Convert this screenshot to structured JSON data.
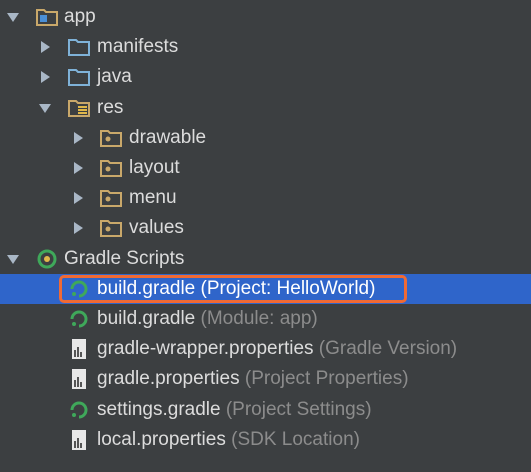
{
  "tree": {
    "rows": [
      {
        "label": "app",
        "secondary": "",
        "icon": "module-folder-icon",
        "arrow": "expanded"
      },
      {
        "label": "manifests",
        "secondary": "",
        "icon": "folder-icon",
        "arrow": "collapsed"
      },
      {
        "label": "java",
        "secondary": "",
        "icon": "folder-icon",
        "arrow": "collapsed"
      },
      {
        "label": "res",
        "secondary": "",
        "icon": "resource-folder-icon",
        "arrow": "expanded"
      },
      {
        "label": "drawable",
        "secondary": "",
        "icon": "package-folder-icon",
        "arrow": "collapsed"
      },
      {
        "label": "layout",
        "secondary": "",
        "icon": "package-folder-icon",
        "arrow": "collapsed"
      },
      {
        "label": "menu",
        "secondary": "",
        "icon": "package-folder-icon",
        "arrow": "collapsed"
      },
      {
        "label": "values",
        "secondary": "",
        "icon": "package-folder-icon",
        "arrow": "collapsed"
      },
      {
        "label": "Gradle Scripts",
        "secondary": "",
        "icon": "gradle-icon",
        "arrow": "expanded"
      },
      {
        "label": "build.gradle (Project: HelloWorld)",
        "secondary": "",
        "icon": "gradle-file-icon",
        "arrow": "none",
        "selected": true
      },
      {
        "label": "build.gradle",
        "secondary": " (Module: app)",
        "icon": "gradle-file-icon",
        "arrow": "none"
      },
      {
        "label": "gradle-wrapper.properties",
        "secondary": " (Gradle Version)",
        "icon": "properties-file-icon",
        "arrow": "none"
      },
      {
        "label": "gradle.properties",
        "secondary": " (Project Properties)",
        "icon": "properties-file-icon",
        "arrow": "none"
      },
      {
        "label": "settings.gradle",
        "secondary": " (Project Settings)",
        "icon": "gradle-file-icon",
        "arrow": "none"
      },
      {
        "label": "local.properties",
        "secondary": " (SDK Location)",
        "icon": "properties-file-icon",
        "arrow": "none"
      }
    ]
  },
  "colors": {
    "background": "#3c3f41",
    "selection": "#2f65ca",
    "highlight_border": "#f06a35",
    "folder_blue": "#7fb2d8",
    "folder_tan": "#c9a86a",
    "gradle_green": "#3fa85a"
  }
}
